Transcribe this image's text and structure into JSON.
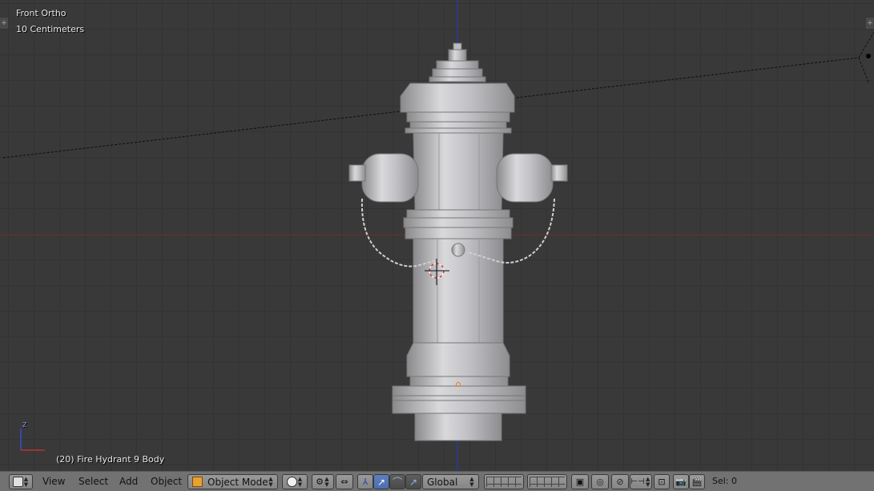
{
  "viewport": {
    "view_name": "Front Ortho",
    "grid_scale": "10 Centimeters",
    "active_object": "(20) Fire Hydrant 9 Body",
    "axis_z": "Z"
  },
  "header": {
    "menus": {
      "view": "View",
      "select": "Select",
      "add": "Add",
      "object": "Object"
    },
    "mode": "Object Mode",
    "orientation": "Global",
    "selection": "Sel: 0"
  },
  "icons": [
    "editor-type-icon",
    "viewport-shading-icon",
    "pivot-point-icon",
    "manipulator-icon",
    "translate-icon",
    "rotate-icon",
    "scale-icon",
    "layers-icon",
    "lock-camera-icon",
    "proportional-edit-icon",
    "snap-icon",
    "snap-element-icon",
    "render-icon",
    "animation-icon"
  ],
  "colors": {
    "header_bg": "#727272",
    "viewport_bg": "#393939",
    "x_axis": "#8b2f2f",
    "z_axis": "#2e3da0",
    "active_button": "#5b7fbf"
  }
}
